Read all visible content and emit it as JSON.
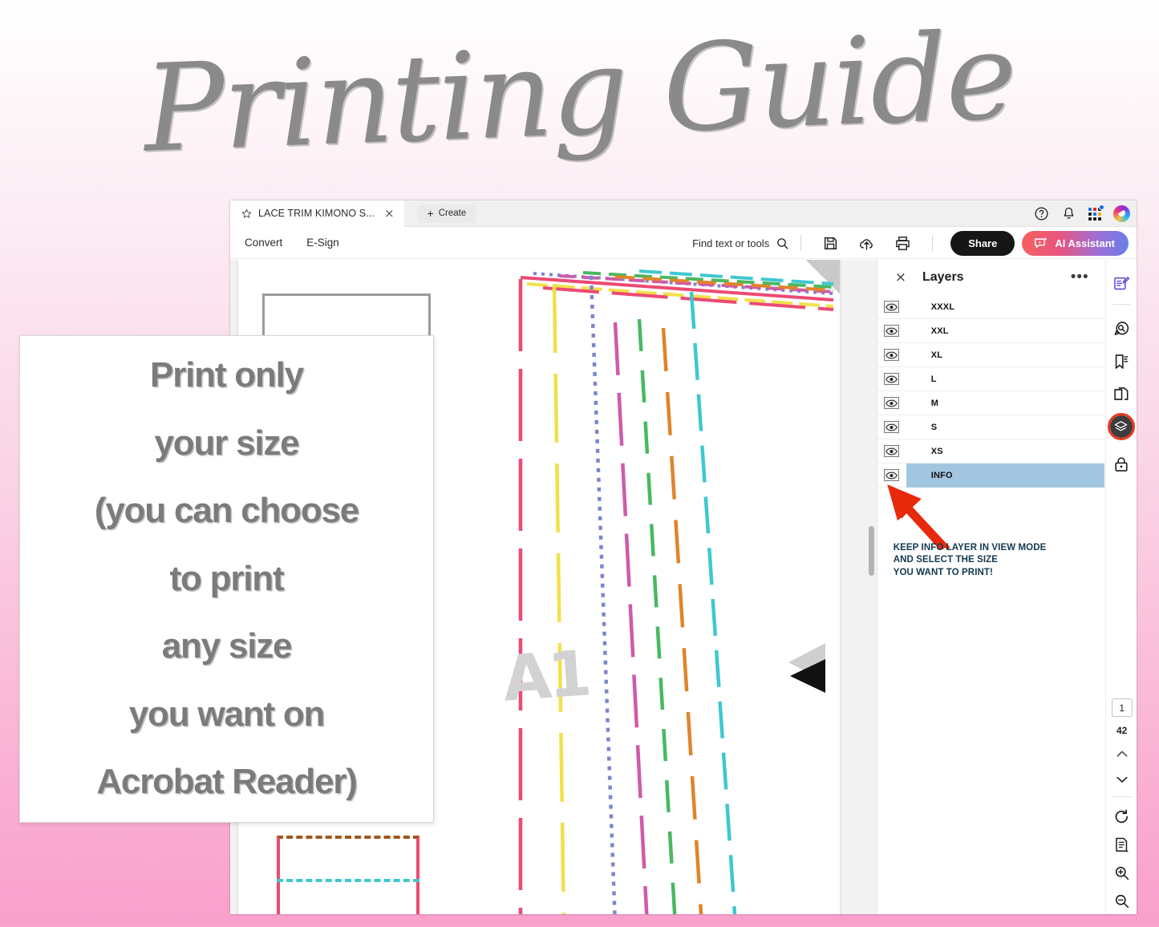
{
  "guide": {
    "title": "Printing Guide"
  },
  "print_card": {
    "lines": [
      "Print only",
      "your size",
      "(you can choose",
      "to print",
      "any size",
      "you want on",
      "Acrobat Reader)"
    ]
  },
  "window": {
    "tab": {
      "title": "LACE TRIM KIMONO S...",
      "close": "×",
      "star_icon": "star-icon"
    },
    "create_tab": {
      "label": "Create",
      "plus": "+"
    },
    "header_icons": [
      "help-icon",
      "notification-bell-icon",
      "app-grid-icon",
      "avatar-icon"
    ]
  },
  "menubar": {
    "items": [
      "Convert",
      "E-Sign"
    ],
    "find": {
      "label": "Find text or tools",
      "icon": "search-icon"
    },
    "tools": [
      "save-icon",
      "upload-cloud-icon",
      "print-icon"
    ],
    "share_label": "Share",
    "ai_label": "AI Assistant"
  },
  "layers_panel": {
    "title": "Layers",
    "close": "×",
    "menu": "•••",
    "rows": [
      {
        "name": "XXXL",
        "selected": false
      },
      {
        "name": "XXL",
        "selected": false
      },
      {
        "name": "XL",
        "selected": false
      },
      {
        "name": "L",
        "selected": false
      },
      {
        "name": "M",
        "selected": false
      },
      {
        "name": "S",
        "selected": false
      },
      {
        "name": "XS",
        "selected": false
      },
      {
        "name": "INFO",
        "selected": true
      }
    ],
    "annotation": {
      "line1": "KEEP INFO LAYER IN VIEW MODE",
      "line2": "AND SELECT THE SIZE",
      "line3": "YOU WANT TO PRINT!",
      "color": "#12384f",
      "arrow_color": "#e8290b"
    },
    "highlight_color": "#a3c6e0"
  },
  "right_rail": {
    "icons": [
      "edit-document-icon",
      "comment-icon",
      "bookmark-icon",
      "pages-copy-icon",
      "layers-icon",
      "lock-icon"
    ],
    "selected_icon": "layers-icon",
    "selected_ring_color": "#e8381e"
  },
  "page_nav": {
    "current_page": "1",
    "total_pages": "42",
    "up": "chevron-up-icon",
    "down": "chevron-down-icon",
    "rotate": "rotate-icon",
    "fit": "fit-page-icon",
    "zoom_in": "zoom-in-icon",
    "zoom_out": "zoom-out-icon"
  },
  "document": {
    "watermark": "A1",
    "pattern_colors": {
      "pink": "#eb4a74",
      "yellow": "#f2e04a",
      "periwinkle": "#7b85cf",
      "magenta": "#cf5aab",
      "green": "#49b862",
      "orange": "#e0842b",
      "cyan": "#3ec8cf",
      "brown": "#a0561c"
    }
  },
  "colors": {
    "background_top": "#ffffff",
    "background_bottom": "#f9a0cc",
    "share_bg": "#161616",
    "title_gray": "#8a8a8a"
  }
}
